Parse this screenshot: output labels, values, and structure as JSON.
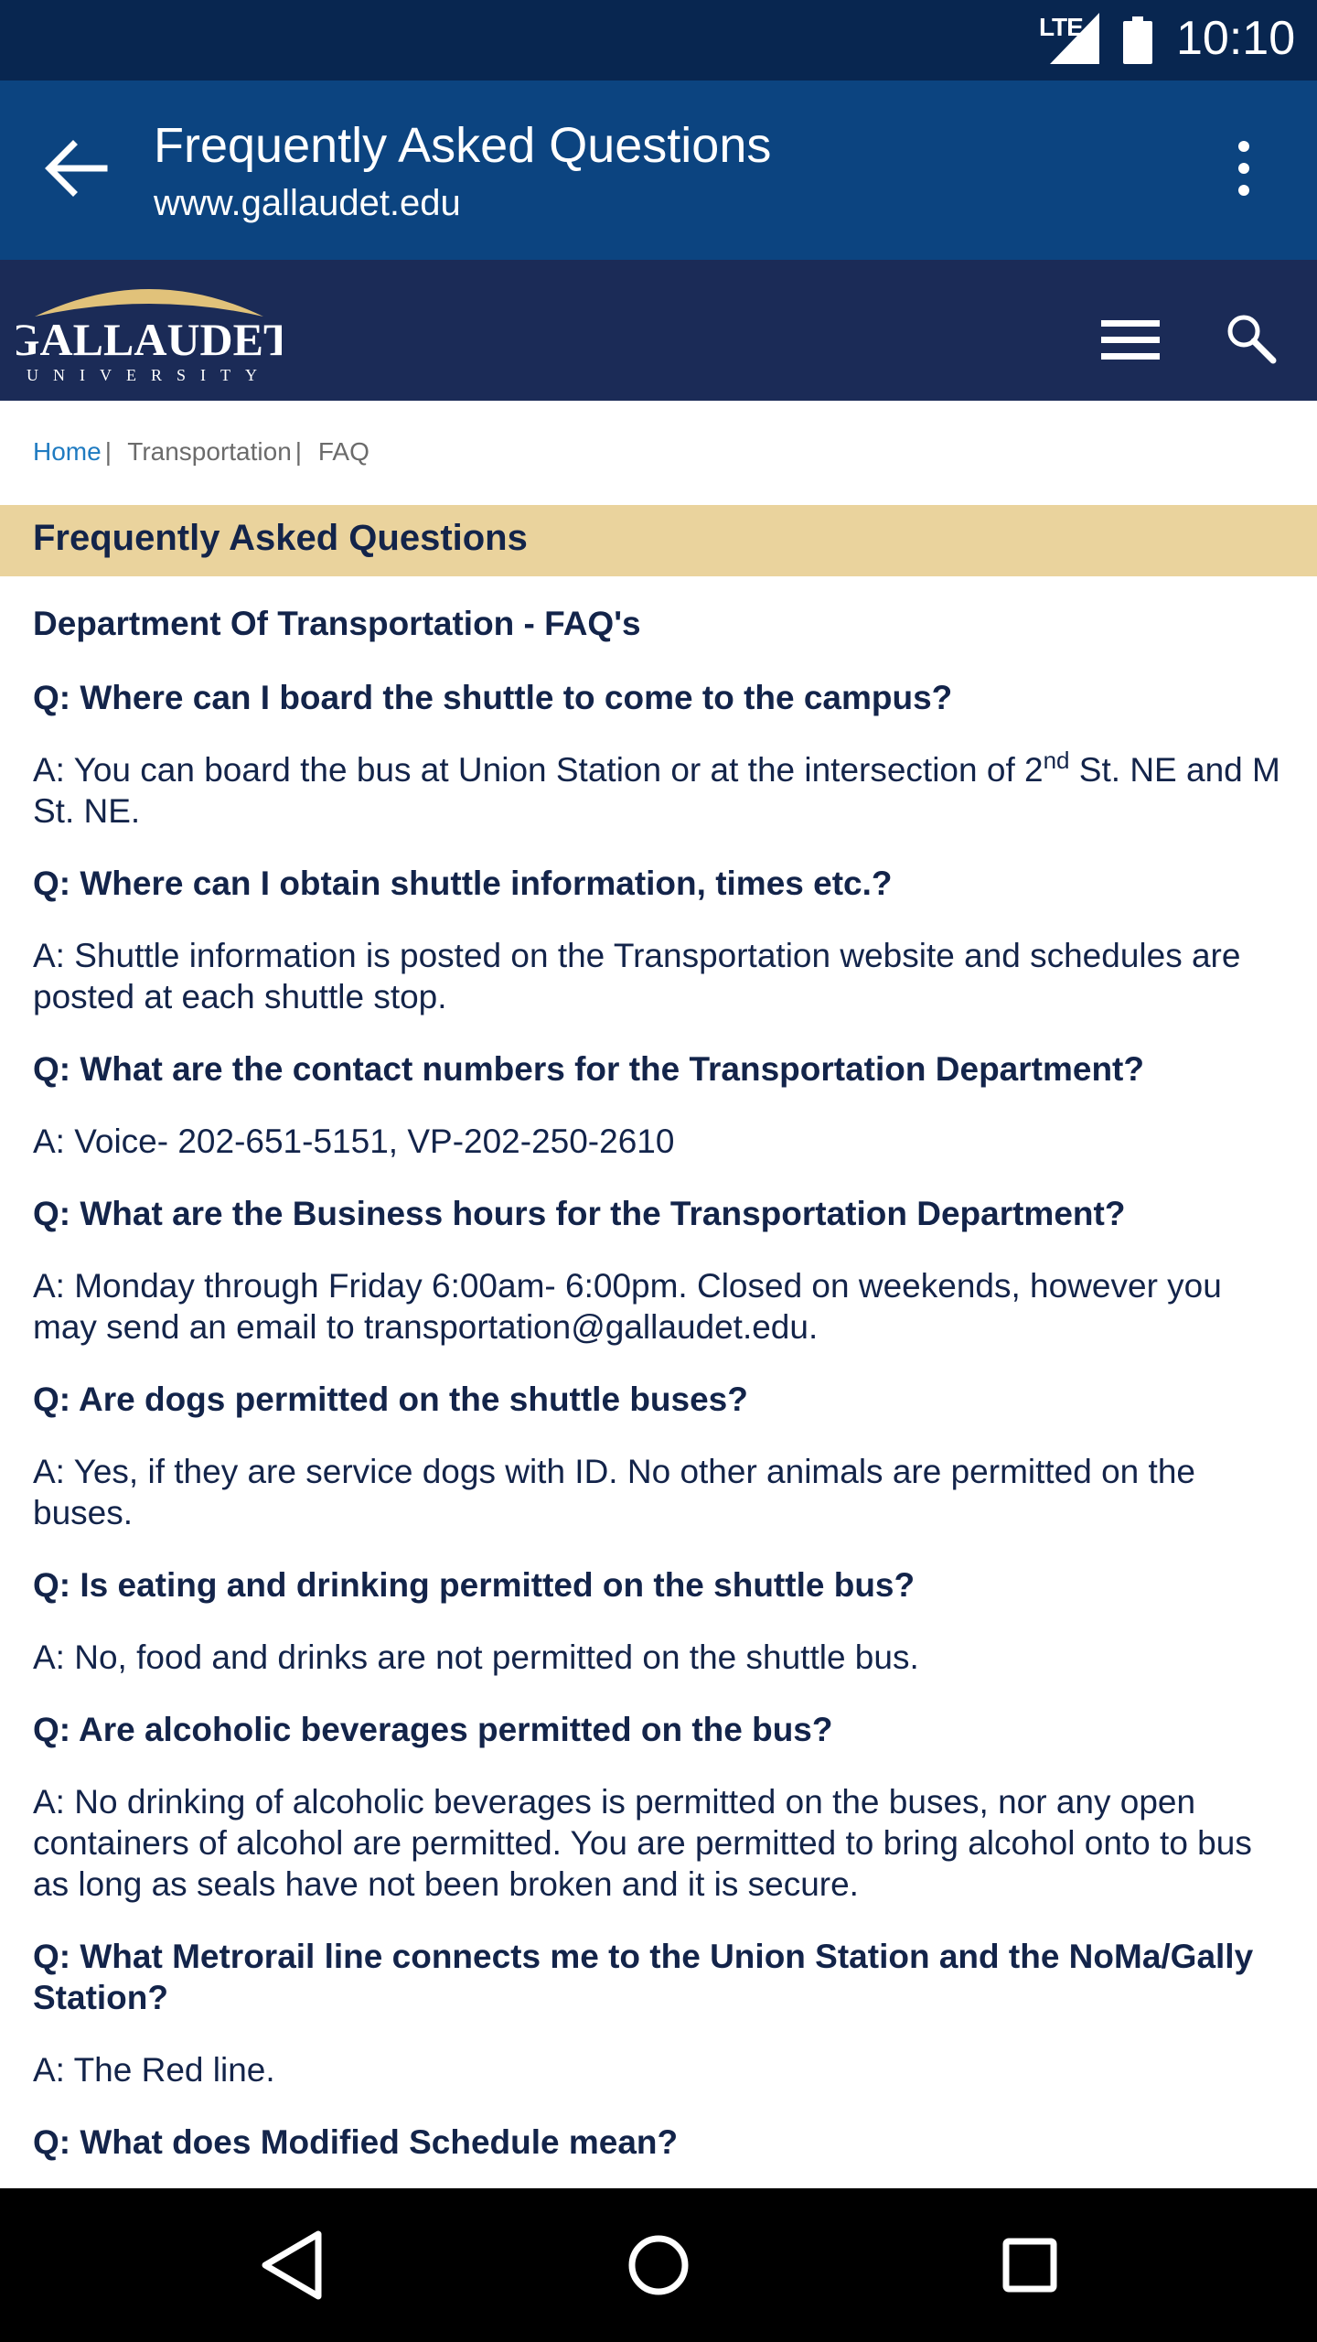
{
  "status_bar": {
    "network": "LTE",
    "time": "10:10",
    "icons": [
      "signal-icon",
      "battery-icon"
    ]
  },
  "browser": {
    "page_title": "Frequently Asked Questions",
    "url": "www.gallaudet.edu",
    "icons": [
      "back-arrow-icon",
      "more-options-icon"
    ]
  },
  "site_header": {
    "logo_text": "GALLAUDET",
    "logo_subtext": "UNIVERSITY",
    "icons": [
      "hamburger-menu-icon",
      "search-icon"
    ]
  },
  "breadcrumb": {
    "items": [
      "Home",
      "Transportation",
      "FAQ"
    ],
    "separator": "|"
  },
  "section_title": "Frequently Asked Questions",
  "department_heading": "Department Of Transportation - FAQ's",
  "faqs": [
    {
      "q": "Q:  Where can I board the shuttle to come to the campus?",
      "a_pre": "A:  You can board the bus at Union Station or at the intersection of 2",
      "a_sup": "nd",
      "a_post": " St. NE and M St. NE."
    },
    {
      "q": "Q:  Where can I obtain shuttle information, times etc.?",
      "a": "A:  Shuttle information is posted on the Transportation website and schedules are posted at each shuttle stop."
    },
    {
      "q": "Q:  What are the contact numbers for the Transportation Department?",
      "a": "A:  Voice- 202-651-5151, VP-202-250-2610"
    },
    {
      "q": "Q:  What are the Business hours for the Transportation Department?",
      "a": "A:  Monday through Friday 6:00am- 6:00pm. Closed on weekends, however you may send an email to transportation@gallaudet.edu."
    },
    {
      "q": "Q:  Are dogs permitted on the shuttle buses?",
      "a": "A:  Yes, if they are service dogs with ID. No other animals are permitted on the buses."
    },
    {
      "q": "Q:  Is eating and drinking permitted on the shuttle bus?",
      "a": "A:  No, food and drinks are not permitted on the shuttle bus."
    },
    {
      "q": "Q:  Are alcoholic beverages permitted on the bus?",
      "a": "A:  No drinking of alcoholic beverages is permitted on the buses, nor any open containers of alcohol are permitted. You are permitted to bring alcohol onto to bus as long as seals have not been broken and it is secure."
    },
    {
      "q": "Q:  What Metrorail line connects me to the Union Station and the NoMa/Gally Station?",
      "a": "A:  The Red line."
    },
    {
      "q": "Q:  What does Modified Schedule mean?"
    }
  ],
  "nav_bar": {
    "icons": [
      "back-triangle-icon",
      "home-circle-icon",
      "recents-square-icon"
    ]
  },
  "colors": {
    "status_bar": "#082650",
    "toolbar": "#0c4480",
    "site_header": "#1b2b57",
    "banner": "#ead39d",
    "link": "#1f7bc1",
    "text": "#13244a"
  }
}
